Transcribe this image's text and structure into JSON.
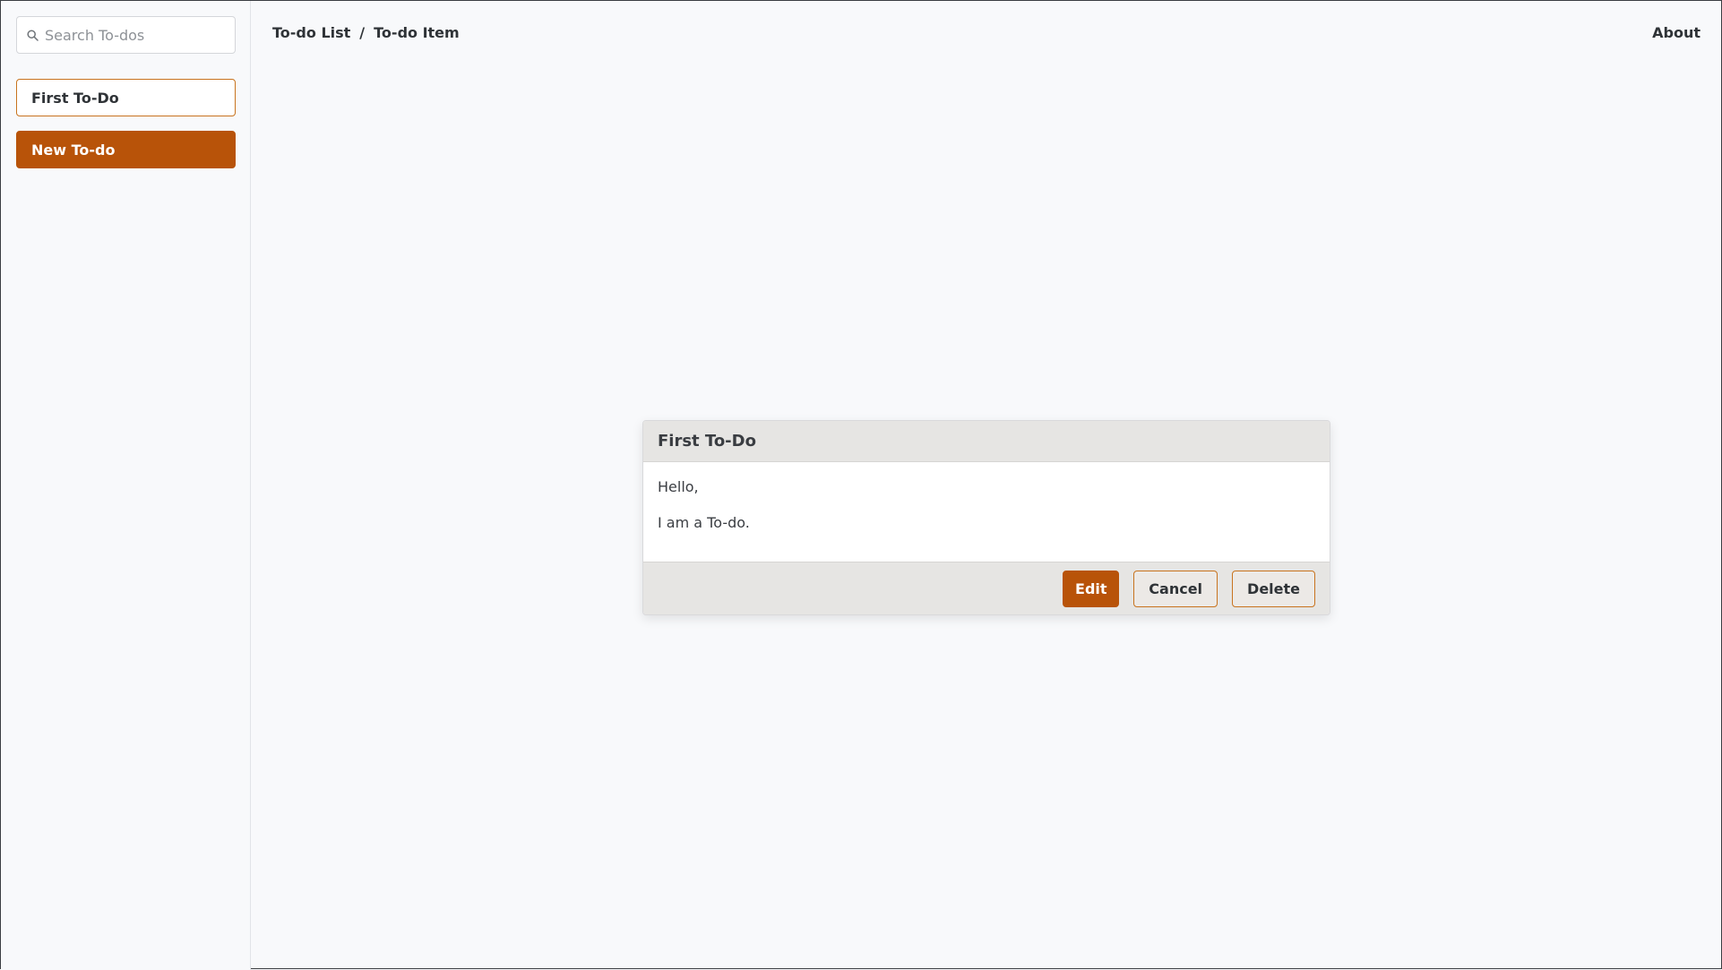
{
  "sidebar": {
    "search_placeholder": "Search To-dos",
    "items": [
      {
        "label": "First To-Do",
        "style": "outline"
      },
      {
        "label": "New To-do",
        "style": "filled"
      }
    ]
  },
  "breadcrumb": {
    "root": "To-do List",
    "separator": "/",
    "current": "To-do Item"
  },
  "header": {
    "about_label": "About"
  },
  "todo_card": {
    "title": "First To-Do",
    "body_lines": [
      "Hello,",
      "I am a To-do."
    ],
    "buttons": {
      "edit": "Edit",
      "cancel": "Cancel",
      "delete": "Delete"
    }
  },
  "colors": {
    "accent": "#b85309",
    "accent_border": "#c8731e",
    "background": "#f8f9fb",
    "card_header": "#e6e5e3"
  }
}
